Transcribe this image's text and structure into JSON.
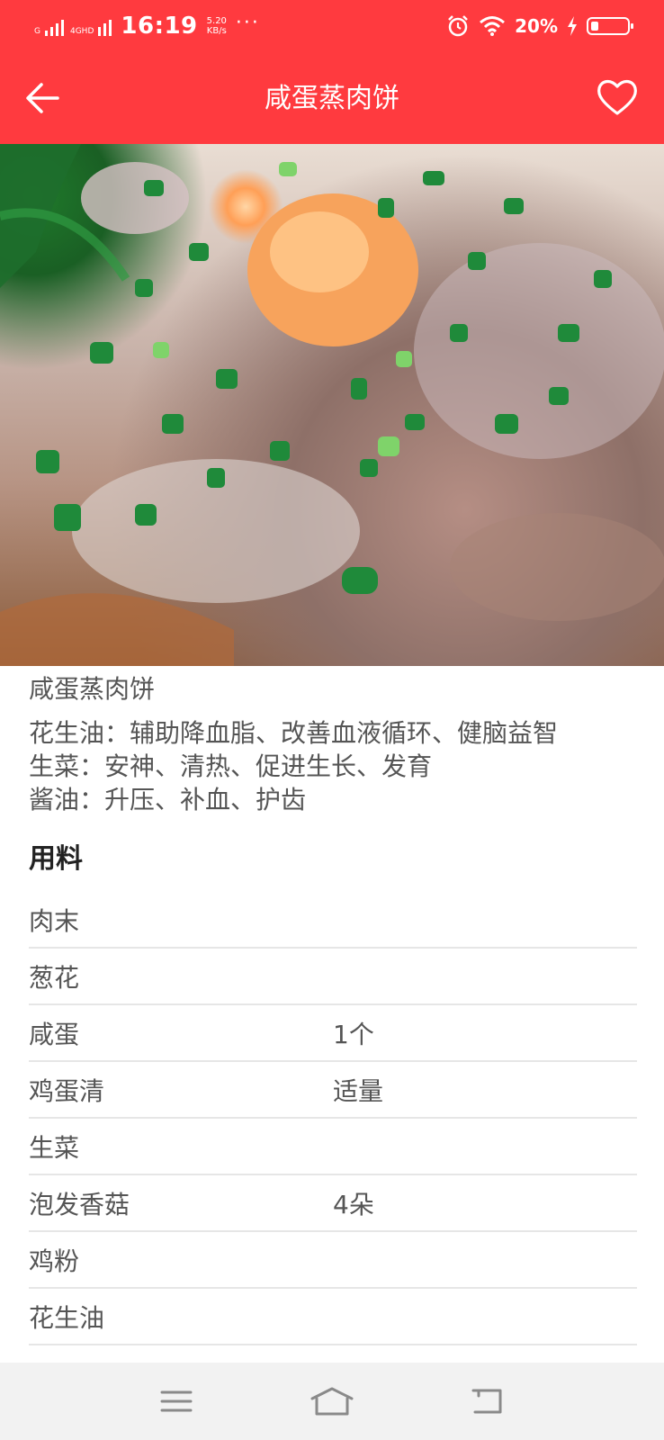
{
  "status_bar": {
    "network_tag": "G",
    "network_tag2": "4GHD",
    "time": "16:19",
    "speed_value": "5.20",
    "speed_unit": "KB/s",
    "more": "···",
    "battery_percent": "20%",
    "icons": [
      "alarm-icon",
      "wifi-icon",
      "charging-icon",
      "battery-icon"
    ]
  },
  "app_bar": {
    "title": "咸蛋蒸肉饼",
    "back_icon": "back-arrow-icon",
    "favorite_icon": "heart-outline-icon",
    "color": "#ff3a3f"
  },
  "recipe": {
    "name": "咸蛋蒸肉饼",
    "benefits": [
      "花生油：辅助降血脂、改善血液循环、健脑益智",
      "生菜：安神、清热、促进生长、发育",
      "酱油：升压、补血、护齿"
    ],
    "ingredients_title": "用料",
    "ingredients": [
      {
        "name": "肉末",
        "amount": ""
      },
      {
        "name": "葱花",
        "amount": ""
      },
      {
        "name": "咸蛋",
        "amount": "1个"
      },
      {
        "name": "鸡蛋清",
        "amount": "适量"
      },
      {
        "name": "生菜",
        "amount": ""
      },
      {
        "name": "泡发香菇",
        "amount": "4朵"
      },
      {
        "name": "鸡粉",
        "amount": ""
      },
      {
        "name": "花生油",
        "amount": ""
      }
    ]
  },
  "nav_bar": {
    "icons": [
      "menu-icon",
      "home-icon",
      "back-icon"
    ]
  }
}
